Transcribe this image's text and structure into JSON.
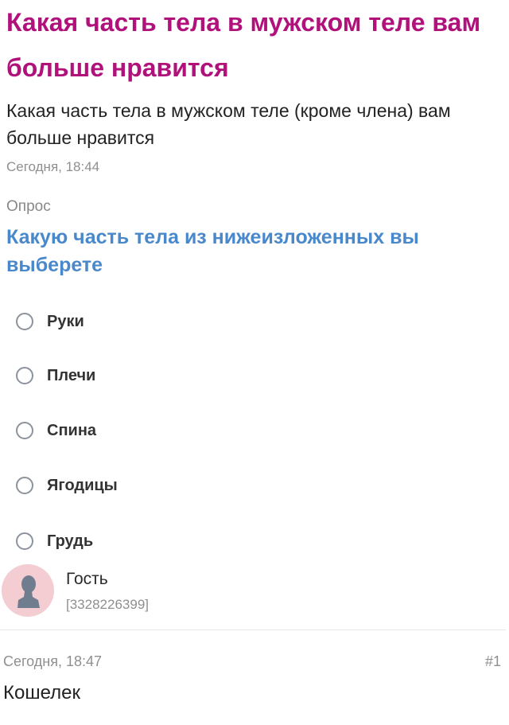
{
  "thread": {
    "title": "Какая часть тела в мужском теле вам больше нравится",
    "body": "Какая часть тела в мужском теле (кроме члена) вам больше нравится",
    "timestamp": "Сегодня, 18:44"
  },
  "poll": {
    "label": "Опрос",
    "question": "Какую часть тела из нижеизложенных вы выберете",
    "options": [
      {
        "label": "Руки"
      },
      {
        "label": "Плечи"
      },
      {
        "label": "Спина"
      },
      {
        "label": "Ягодицы"
      },
      {
        "label": "Грудь"
      }
    ]
  },
  "author": {
    "name": "Гость",
    "id": "[3328226399]",
    "avatar_icon": "user-silhouette-icon",
    "avatar_color": "#f4cdd3"
  },
  "reply": {
    "timestamp": "Сегодня, 18:47",
    "number": "#1",
    "body": "Кошелек"
  },
  "colors": {
    "title": "#b0117a",
    "poll_question": "#4a88cc",
    "muted": "#8f8f8f"
  }
}
